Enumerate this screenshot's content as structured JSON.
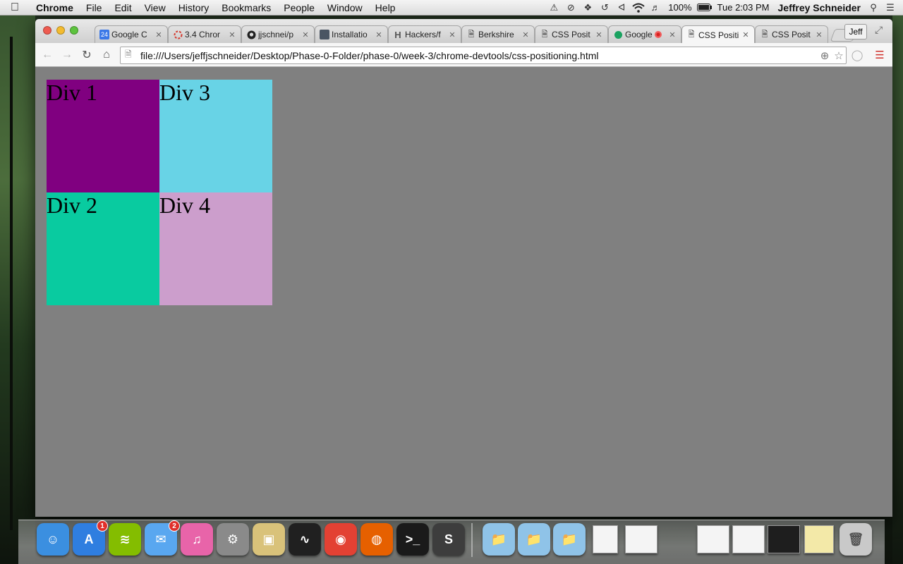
{
  "menubar": {
    "apple_icon": "apple-icon",
    "app_name": "Chrome",
    "items": [
      "File",
      "Edit",
      "View",
      "History",
      "Bookmarks",
      "People",
      "Window",
      "Help"
    ],
    "battery": "100%",
    "clock": "Tue 2:03 PM",
    "user": "Jeffrey Schneider"
  },
  "browser": {
    "tabs": [
      {
        "title": "Google C",
        "icon": "calendar-icon",
        "icon_text": "24"
      },
      {
        "title": "3.4 Chror",
        "icon": "loading-icon"
      },
      {
        "title": "jjschnei/p",
        "icon": "github-icon"
      },
      {
        "title": "Installatio",
        "icon": "app-icon"
      },
      {
        "title": "Hackers/f",
        "icon": "hackers-icon",
        "icon_text": "H"
      },
      {
        "title": "Berkshire",
        "icon": "page-icon"
      },
      {
        "title": "CSS Posit",
        "icon": "page-icon"
      },
      {
        "title": "Google",
        "icon": "hangouts-icon"
      },
      {
        "title": "CSS Positi",
        "icon": "page-icon",
        "active": true
      },
      {
        "title": "CSS Posit",
        "icon": "page-icon"
      }
    ],
    "profile_label": "Jeff",
    "url": "file:///Users/jeffjschneider/Desktop/Phase-0-Folder/phase-0/week-3/chrome-devtools/css-positioning.html"
  },
  "page": {
    "background": "#808080",
    "divs": [
      {
        "label": "Div 1",
        "color": "#800080"
      },
      {
        "label": "Div 2",
        "color": "#09cba0"
      },
      {
        "label": "Div 3",
        "color": "#68d3e6"
      },
      {
        "label": "Div 4",
        "color": "#cc9ecc"
      }
    ]
  },
  "dock": {
    "items": [
      {
        "name": "finder-icon",
        "color": "#3b8fe0"
      },
      {
        "name": "app-store-icon",
        "color": "#2f7ee0",
        "badge": "1"
      },
      {
        "name": "spotify-icon",
        "color": "#84bd00"
      },
      {
        "name": "messages-icon",
        "color": "#59a7f0",
        "badge": "2"
      },
      {
        "name": "itunes-icon",
        "color": "#e864a9"
      },
      {
        "name": "system-preferences-icon",
        "color": "#8a8a8a"
      },
      {
        "name": "preview-icon",
        "color": "#d9c27a"
      },
      {
        "name": "activity-monitor-icon",
        "color": "#202020"
      },
      {
        "name": "chrome-icon",
        "color": "#e34133"
      },
      {
        "name": "firefox-icon",
        "color": "#e66000"
      },
      {
        "name": "terminal-icon",
        "color": "#1a1a1a"
      },
      {
        "name": "sublime-text-icon",
        "color": "#3d3d3d"
      }
    ]
  }
}
